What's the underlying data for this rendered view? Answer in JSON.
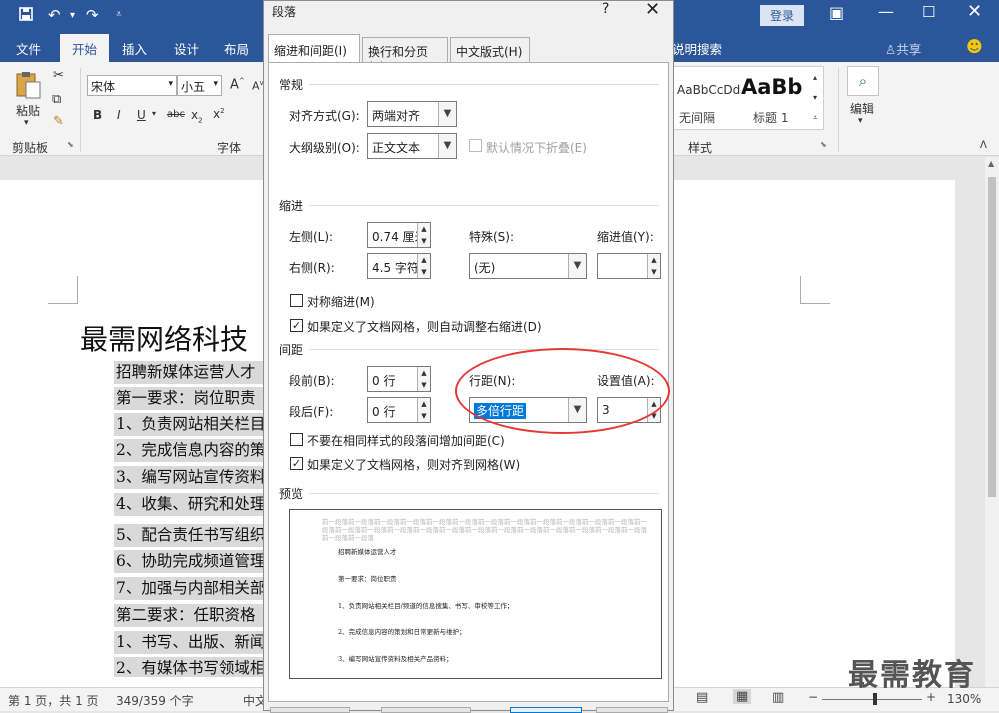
{
  "window": {
    "login": "登录",
    "search_tab": "说明搜索",
    "share": "共享"
  },
  "tabs": [
    "文件",
    "开始",
    "插入",
    "设计",
    "布局"
  ],
  "ribbon": {
    "paste": "粘贴",
    "clipboard": "剪贴板",
    "font_name": "宋体",
    "font_size": "小五",
    "font_group": "字体",
    "styles": [
      "AaBbCcDd",
      "AaBb"
    ],
    "style_names": [
      "无间隔",
      "标题 1"
    ],
    "styles_group": "样式",
    "edit": "编辑"
  },
  "document": {
    "title": "最需网络科技",
    "lines": [
      "招聘新媒体运营人才",
      "第一要求：岗位职责",
      "1、负责网站相关栏目",
      "2、完成信息内容的策",
      "3、编写网站宣传资料",
      "4、收集、研究和处理",
      "5、配合责任书写组织",
      "6、协助完成频道管理",
      "7、加强与内部相关部",
      "第二要求：任职资格",
      "1、书写、出版、新闻",
      "2、有媒体书写领域相"
    ]
  },
  "status": {
    "page": "第 1 页，共 1 页",
    "words": "349/359 个字",
    "lang": "中文",
    "zoom": "130%"
  },
  "dialog": {
    "title": "段落",
    "help": "?",
    "tabs": [
      "缩进和间距(I)",
      "换行和分页(P)",
      "中文版式(H)"
    ],
    "general": {
      "heading": "常规",
      "align_label": "对齐方式(G):",
      "align_value": "两端对齐",
      "outline_label": "大纲级别(O):",
      "outline_value": "正文文本",
      "collapse_label": "默认情况下折叠(E)"
    },
    "indent": {
      "heading": "缩进",
      "left_label": "左侧(L):",
      "left_value": "0.74 厘米",
      "right_label": "右侧(R):",
      "right_value": "4.5 字符",
      "special_label": "特殊(S):",
      "special_value": "(无)",
      "by_label": "缩进值(Y):",
      "by_value": "",
      "mirror_label": "对称缩进(M)",
      "auto_adjust_label": "如果定义了文档网格，则自动调整右缩进(D)"
    },
    "spacing": {
      "heading": "间距",
      "before_label": "段前(B):",
      "before_value": "0 行",
      "after_label": "段后(F):",
      "after_value": "0 行",
      "line_label": "行距(N):",
      "line_value": "多倍行距",
      "at_label": "设置值(A):",
      "at_value": "3",
      "no_space_label": "不要在相同样式的段落间增加间距(C)",
      "snap_grid_label": "如果定义了文档网格，则对齐到网格(W)"
    },
    "preview": {
      "heading": "预览",
      "prev_text": "前一段落前一段落前一段落前一段落前一段落前一段落前一段落前一段落前一段落前一段落前一段落前一段落前一段落前一段落前一段落前一段落前一段落前一段落前一段落前一段落前一段落前一段落前一段落前一段落前一段落前一段落前一段落",
      "lines": [
        "招聘新媒体运营人才",
        "第一要求：岗位职责",
        "1、负责网站相关栏目/频道的信息搜集、书写、审校等工作；",
        "2、完成信息内容的策划和日常更新与维护；",
        "3、编写网站宣传资料及相关产品资料；"
      ]
    }
  },
  "watermark": "最需教育"
}
